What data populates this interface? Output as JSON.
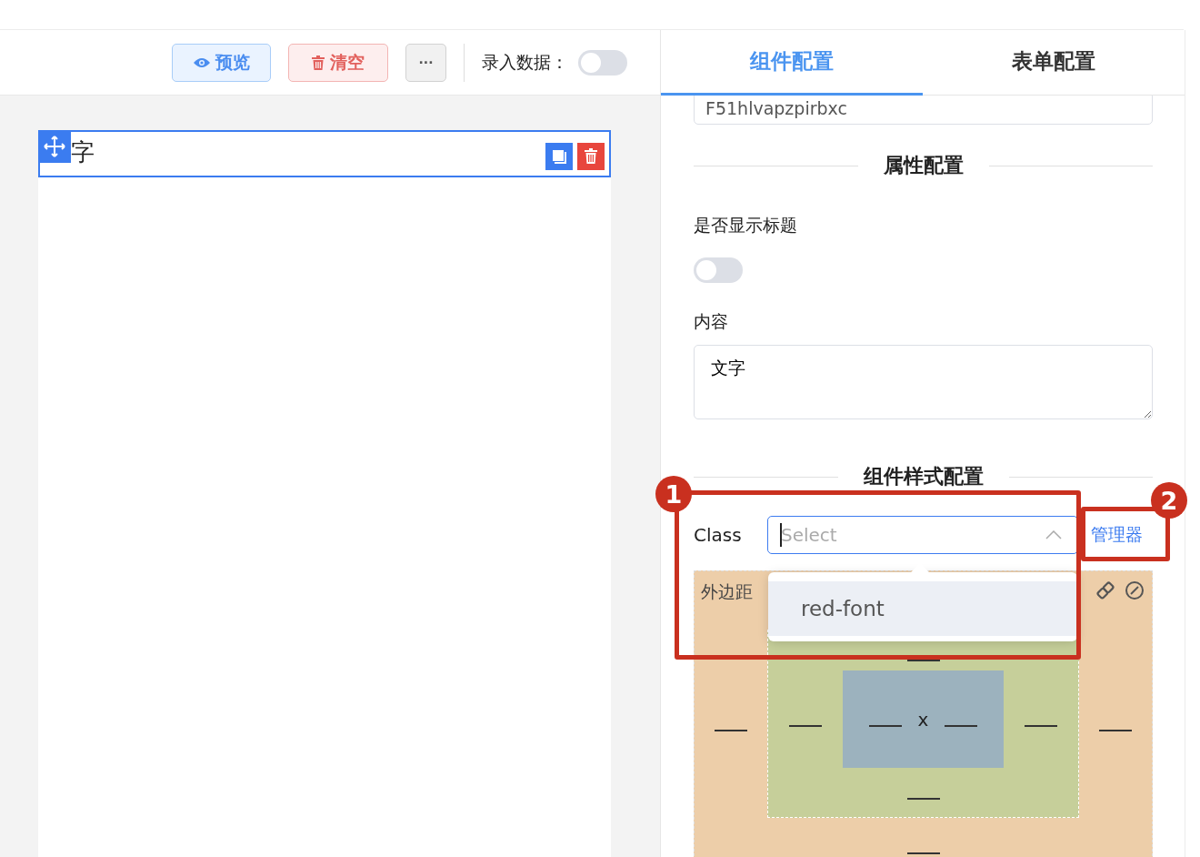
{
  "toolbar": {
    "buttons": [
      {
        "kind": "preview",
        "label": "预览"
      },
      {
        "kind": "clear",
        "label": "清空"
      },
      {
        "kind": "more",
        "label": "···"
      }
    ],
    "entry_label": "录入数据：",
    "entry_toggle": {
      "on": false
    }
  },
  "canvas": {
    "items": [
      {
        "text": "字",
        "selected": true
      }
    ]
  },
  "tabs": [
    {
      "label": "组件配置",
      "selected": true
    },
    {
      "label": "表单配置",
      "selected": false
    }
  ],
  "id_field": {
    "value": "F51hlvapzpirbxc"
  },
  "attributes": {
    "title": "属性配置",
    "show_title_label": "是否显示标题",
    "show_title": {
      "on": false
    },
    "content_label": "内容",
    "content_value": "文字"
  },
  "style": {
    "title": "组件样式配置",
    "class_label": "Class",
    "class_placeholder": "Select",
    "manage_link": "管理器",
    "options": [
      {
        "label": "red-font",
        "hovered": true
      }
    ],
    "margin_label": "外边距",
    "times": "x"
  },
  "annotations": [
    {
      "number": "1"
    },
    {
      "number": "2"
    }
  ]
}
